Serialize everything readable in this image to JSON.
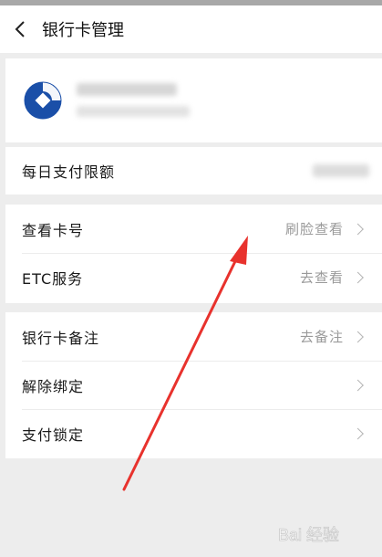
{
  "header": {
    "title": "银行卡管理"
  },
  "card": {
    "logo_icon": "bank-logo"
  },
  "limit_row": {
    "label": "每日支付限额"
  },
  "rows_a": [
    {
      "label": "查看卡号",
      "value": "刷脸查看"
    },
    {
      "label": "ETC服务",
      "value": "去查看"
    }
  ],
  "rows_b": [
    {
      "label": "银行卡备注",
      "value": "去备注"
    },
    {
      "label": "解除绑定",
      "value": ""
    },
    {
      "label": "支付锁定",
      "value": ""
    }
  ],
  "colors": {
    "arrow": "#e8322d",
    "logo": "#1a4fa8"
  },
  "watermark": {
    "text": "Bai 经验"
  }
}
